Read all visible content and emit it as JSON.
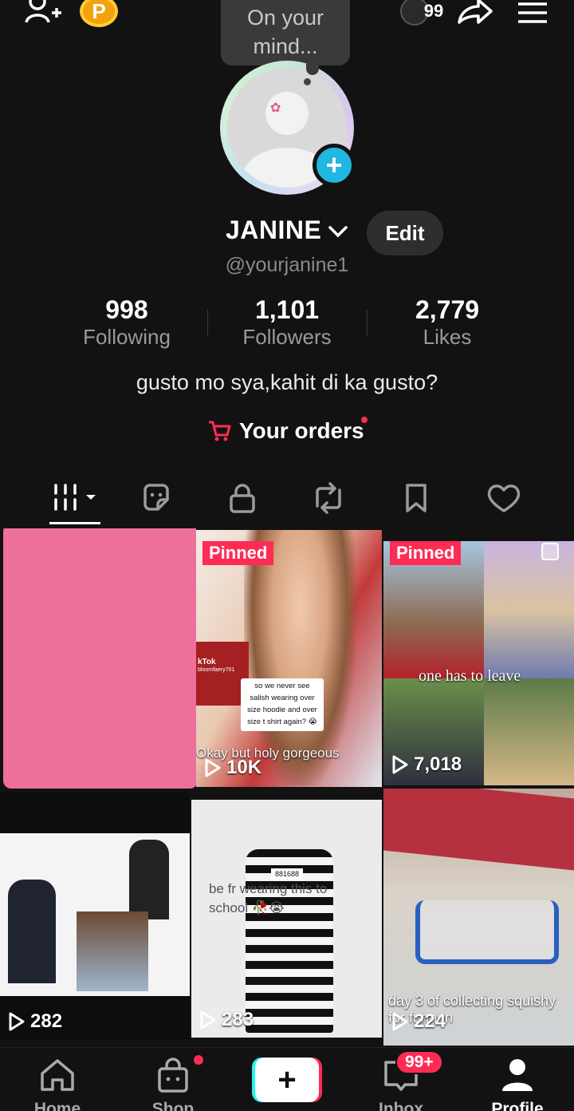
{
  "topbar": {
    "badge_count": "99",
    "coin_letter": "P"
  },
  "bubble": {
    "text_line1": "On your",
    "text_line2": "mind..."
  },
  "profile": {
    "name": "JANINE",
    "edit_label": "Edit",
    "handle": "@yourjanine1",
    "stats": [
      {
        "value": "998",
        "label": "Following"
      },
      {
        "value": "1,101",
        "label": "Followers"
      },
      {
        "value": "2,779",
        "label": "Likes"
      }
    ],
    "bio": "gusto mo sya,kahit di ka gusto?",
    "orders_label": "Your orders"
  },
  "videos": [
    {
      "views": ""
    },
    {
      "pinned": "Pinned",
      "views": "10K",
      "caption": "Okay but holy gorgeous",
      "sticker_lines": [
        "so we never see",
        "salish wearing over",
        "size hoodie and over",
        "size t shirt again? 😭"
      ],
      "tiktok_mark": "kTok",
      "tiktok_user": "bloomfaery701"
    },
    {
      "pinned": "Pinned",
      "views": "7,018",
      "caption": "one has to leave"
    },
    {
      "views": "282"
    },
    {
      "views": "283",
      "caption": "be fr wearing this to school 🥀😭",
      "tag": "881688"
    },
    {
      "views": "224",
      "caption": "day 3 of collecting squishy for funnnn"
    }
  ],
  "nav": {
    "home": "Home",
    "shop": "Shop",
    "inbox": "Inbox",
    "inbox_badge": "99+",
    "profile": "Profile"
  },
  "colors": {
    "accent": "#fe2c55",
    "cyan": "#25f4ee",
    "add_blue": "#20b7e0"
  }
}
